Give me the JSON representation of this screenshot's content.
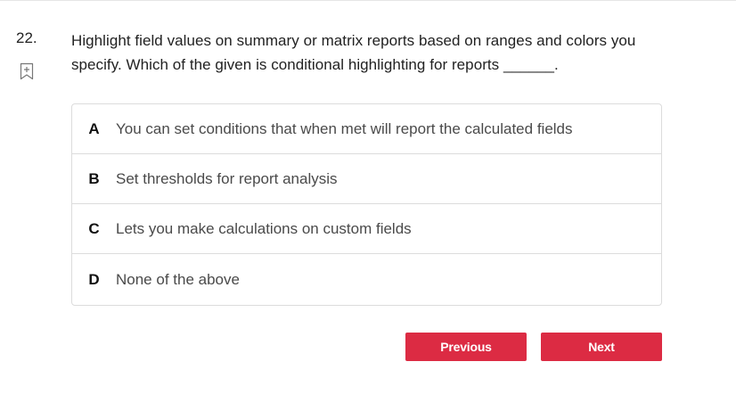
{
  "question": {
    "number": "22.",
    "text": "Highlight field values on summary or matrix reports based on ranges and colors you specify. Which of the given is conditional highlighting for reports ______."
  },
  "bookmark": {
    "icon": "bookmark-add-icon"
  },
  "options": [
    {
      "letter": "A",
      "text": "You can set conditions that when met will report the calculated fields"
    },
    {
      "letter": "B",
      "text": "Set thresholds for report analysis"
    },
    {
      "letter": "C",
      "text": "Lets you make calculations on custom fields"
    },
    {
      "letter": "D",
      "text": "None of the above"
    }
  ],
  "navigation": {
    "previous_label": "Previous",
    "next_label": "Next"
  },
  "colors": {
    "button_bg": "#dc2b43",
    "border": "#dcdcdc",
    "option_text": "#4a4a4a"
  }
}
